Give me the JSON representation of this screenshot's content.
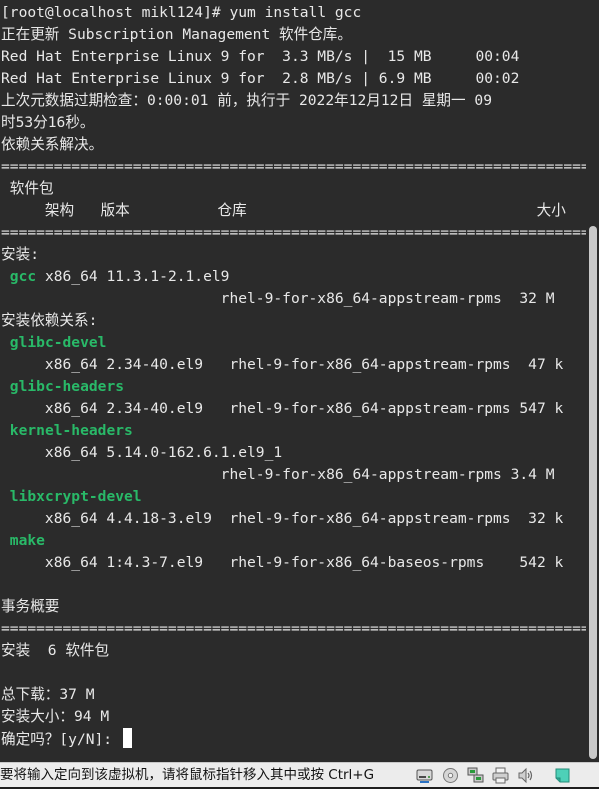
{
  "terminal": {
    "prompt": "[root@localhost mikl124]# ",
    "command": "yum install gcc",
    "updating": "正在更新 Subscription Management 软件仓库。",
    "repo_lines": [
      "Red Hat Enterprise Linux 9 for  3.3 MB/s |  15 MB     00:04",
      "Red Hat Enterprise Linux 9 for  2.8 MB/s | 6.9 MB     00:02"
    ],
    "metadata_check_1": "上次元数据过期检查：0:00:01 前，执行于 2022年12月12日 星期一 09",
    "metadata_check_2": "时53分16秒。",
    "resolving": "依赖关系解决。",
    "separator": "===============================================================================",
    "header_package": " 软件包",
    "header_columns": "     架构   版本          仓库                                 大小",
    "installing_label": "安装:",
    "gcc": {
      "name": "gcc",
      "details": " x86_64 11.3.1-2.1.el9",
      "repo_line": "                         rhel-9-for-x86_64-appstream-rpms  32 M"
    },
    "deps_label": "安装依赖关系:",
    "dependencies": [
      {
        "name": "glibc-devel",
        "line": "     x86_64 2.34-40.el9   rhel-9-for-x86_64-appstream-rpms  47 k"
      },
      {
        "name": "glibc-headers",
        "line": "     x86_64 2.34-40.el9   rhel-9-for-x86_64-appstream-rpms 547 k"
      },
      {
        "name": "kernel-headers",
        "line": "     x86_64 5.14.0-162.6.1.el9_1",
        "line2": "                         rhel-9-for-x86_64-appstream-rpms 3.4 M"
      },
      {
        "name": "libxcrypt-devel",
        "line": "     x86_64 4.4.18-3.el9  rhel-9-for-x86_64-appstream-rpms  32 k"
      },
      {
        "name": "make",
        "line": "     x86_64 1:4.3-7.el9   rhel-9-for-x86_64-baseos-rpms    542 k"
      }
    ],
    "summary_label": "事务概要",
    "install_count": "安装  6 软件包",
    "total_download": "总下载：37 M",
    "installed_size": "安装大小：94 M",
    "confirm_prompt": "确定吗？[y/N]: "
  },
  "statusbar": {
    "hint": "要将输入定向到该虚拟机，请将鼠标指针移入其中或按 Ctrl+G",
    "icons": [
      "hard-disk-icon",
      "cd-rom-icon",
      "network-adapter-icon",
      "printer-icon",
      "sound-icon",
      "message-icon"
    ]
  }
}
